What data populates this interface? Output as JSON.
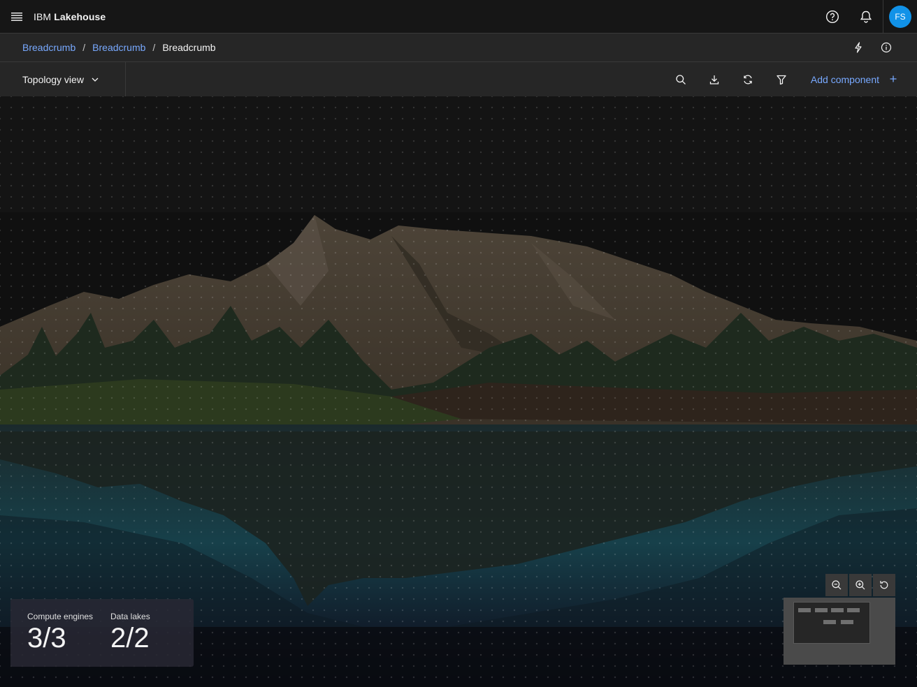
{
  "header": {
    "product_prefix": "IBM",
    "product_name": "Lakehouse",
    "avatar_initials": "FS",
    "icons": [
      "menu-icon",
      "help-icon",
      "notification-icon"
    ]
  },
  "breadcrumb": {
    "items": [
      "Breadcrumb",
      "Breadcrumb"
    ],
    "current": "Breadcrumb",
    "separator": "/",
    "actions": [
      "lightning-icon",
      "information-icon"
    ]
  },
  "toolbar": {
    "view_label": "Topology view",
    "icons": [
      "search-icon",
      "download-icon",
      "refresh-icon",
      "filter-icon"
    ],
    "add_label": "Add component",
    "add_icon": "add-icon"
  },
  "stats": {
    "compute": {
      "label": "Compute engines",
      "value": "3/3"
    },
    "lakes": {
      "label": "Data lakes",
      "value": "2/2"
    }
  },
  "zoom": [
    "zoom-out-icon",
    "zoom-in-icon",
    "reset-icon"
  ],
  "colors": {
    "accent": "#78a9ff",
    "avatar": "#1192e8",
    "background": "#161616",
    "panel": "#262626"
  }
}
